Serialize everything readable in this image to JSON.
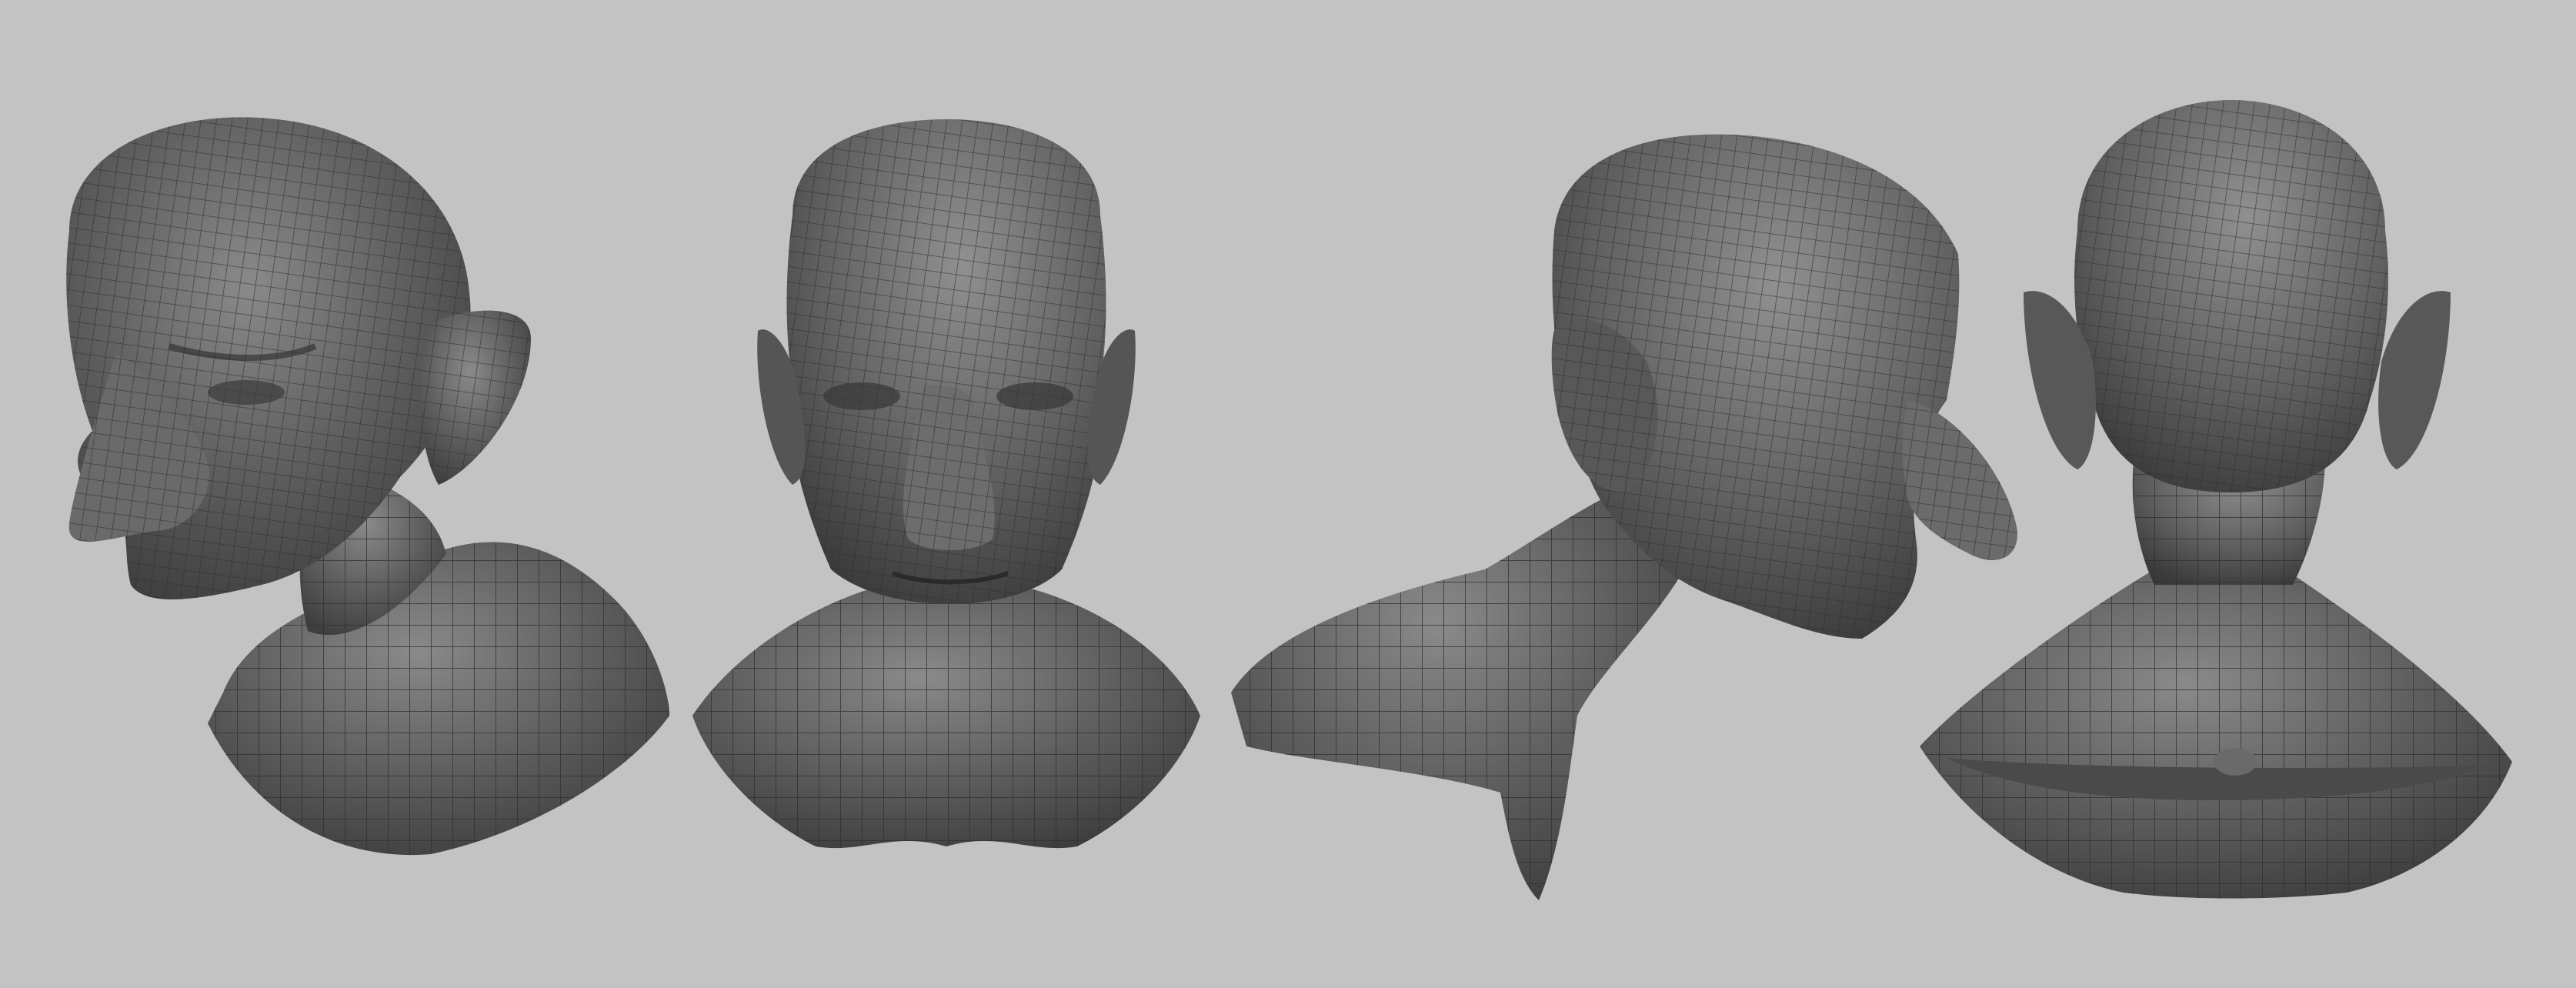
{
  "scene": {
    "background": "#c3c3c3",
    "mesh_color": "#5b5b5b",
    "wire_color": "#2e2e2e",
    "highlight_color": "#9a9a9a",
    "views": [
      {
        "name": "three-quarter-left",
        "label": ""
      },
      {
        "name": "front",
        "label": ""
      },
      {
        "name": "three-quarter-right",
        "label": ""
      },
      {
        "name": "back",
        "label": ""
      }
    ]
  }
}
